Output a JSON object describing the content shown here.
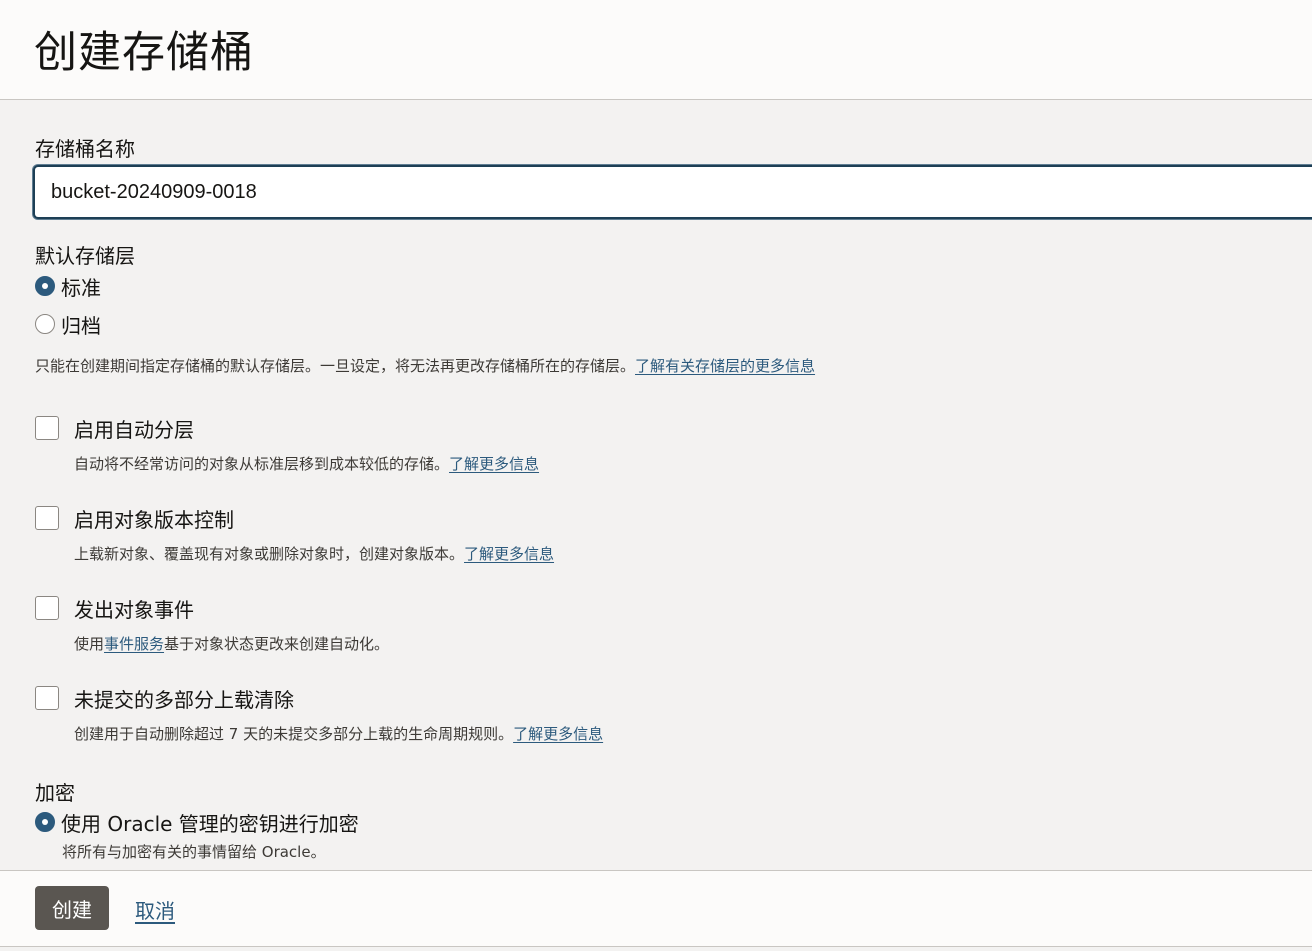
{
  "page": {
    "title": "创建存储桶"
  },
  "bucket_name": {
    "label": "存储桶名称",
    "value": "bucket-20240909-0018"
  },
  "storage_tier": {
    "label": "默认存储层",
    "options": [
      {
        "label": "标准",
        "selected": true
      },
      {
        "label": "归档",
        "selected": false
      }
    ],
    "help_text": "只能在创建期间指定存储桶的默认存储层。一旦设定，将无法再更改存储桶所在的存储层。",
    "help_link": "了解有关存储层的更多信息"
  },
  "options": {
    "auto_tiering": {
      "label": "启用自动分层",
      "checked": false,
      "help_text": "自动将不经常访问的对象从标准层移到成本较低的存储。",
      "help_link": "了解更多信息"
    },
    "versioning": {
      "label": "启用对象版本控制",
      "checked": false,
      "help_text": "上载新对象、覆盖现有对象或删除对象时，创建对象版本。",
      "help_link": "了解更多信息"
    },
    "object_events": {
      "label": "发出对象事件",
      "checked": false,
      "help_prefix": "使用",
      "help_link": "事件服务",
      "help_suffix": "基于对象状态更改来创建自动化。"
    },
    "multipart_cleanup": {
      "label": "未提交的多部分上载清除",
      "checked": false,
      "help_text": "创建用于自动删除超过 7 天的未提交多部分上载的生命周期规则。",
      "help_link": "了解更多信息"
    }
  },
  "encryption": {
    "label": "加密",
    "option_label": "使用 Oracle 管理的密钥进行加密",
    "option_selected": true,
    "option_help": "将所有与加密有关的事情留给 Oracle。"
  },
  "footer": {
    "create_label": "创建",
    "cancel_label": "取消"
  },
  "colors": {
    "accent": "#2c5a7d",
    "primary_button": "#5a5651",
    "background": "#f3f2f1"
  }
}
